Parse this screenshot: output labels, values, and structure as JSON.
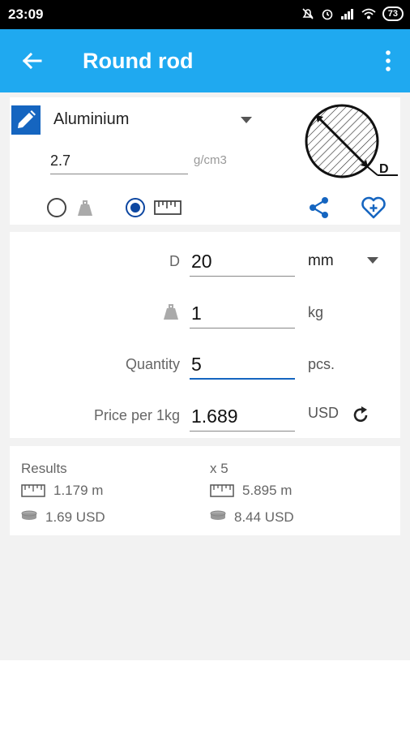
{
  "status_bar": {
    "time": "23:09",
    "battery": "73"
  },
  "app_bar": {
    "title": "Round rod"
  },
  "material": {
    "name": "Aluminium",
    "density": "2.7",
    "density_unit": "g/cm3"
  },
  "diagram": {
    "label": "D"
  },
  "inputs": {
    "d_label": "D",
    "d_value": "20",
    "d_unit": "mm",
    "weight_value": "1",
    "weight_unit": "kg",
    "quantity_label": "Quantity",
    "quantity_value": "5",
    "quantity_unit": "pcs.",
    "price_label": "Price per 1kg",
    "price_value": "1.689",
    "currency": "USD"
  },
  "results": {
    "header": "Results",
    "multiplier": "x 5",
    "length": "1.179 m",
    "total_length": "5.895 m",
    "cost": "1.69 USD",
    "total_cost": "8.44 USD"
  },
  "colors": {
    "accent": "#1fa9f0",
    "primary_dark": "#1565c0",
    "background": "#f2f2f2"
  }
}
